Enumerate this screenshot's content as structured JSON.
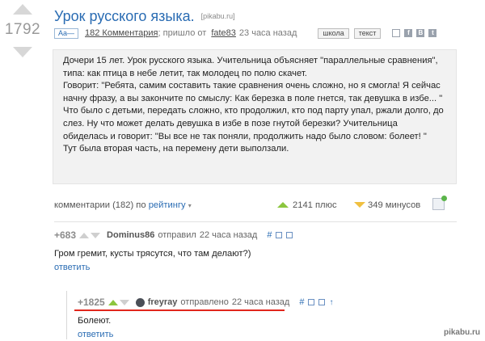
{
  "post": {
    "rating": "1792",
    "title": "Урок русского языка.",
    "domain": "[pikabu.ru]",
    "font_toggle": "Aa—",
    "comments_link": "182 Комментария",
    "posted_prefix": "; пришло от",
    "author": "fate83",
    "time": "23 часа назад",
    "tags": [
      "школа",
      "текст"
    ],
    "body": [
      "Дочери 15 лет. Урок русского языка. Учительница объясняет \"параллельные сравнения\", типа: как птица в небе летит, так молодец по полю скачет.",
      "Говорит: \"Ребята, самим составить такие сравнения очень сложно, но я смогла! Я сейчас начну фразу, а вы закончите по смыслу: Как березка в поле гнется, так девушка в избе... \"",
      "Что было с детьми, передать сложно, кто продолжил, кто под парту упал, ржали долго, до слез. Ну что может делать девушка в избе в позе гнутой березки? Учительница обиделась и говорит: \"Вы все не так поняли, продолжить надо было словом: болеет! \"",
      "Тут была вторая часть, на перемену дети выползали."
    ]
  },
  "comments_bar": {
    "label": "комментарии (182) по",
    "sort": "рейтингу",
    "caret": "▾",
    "plus": "2141 плюс",
    "minus": "349 минусов"
  },
  "comments": [
    {
      "score": "+683",
      "author": "Dominus86",
      "action": "отправил",
      "time": "22 часа назад",
      "hash": "#",
      "text": "Гром гремит, кусты трясутся, что там делают?)",
      "reply": "ответить"
    },
    {
      "score": "+1825",
      "author": "freyray",
      "action": "отправлено",
      "time": "22 часа назад",
      "hash": "#",
      "arrow": "↑",
      "text": "Болеют.",
      "reply": "ответить"
    }
  ],
  "watermark": "pikabu.ru",
  "colors": {
    "link": "#2a6cb3",
    "plus": "#8cc63f",
    "minus": "#f0c040",
    "highlight": "#e1261c"
  }
}
